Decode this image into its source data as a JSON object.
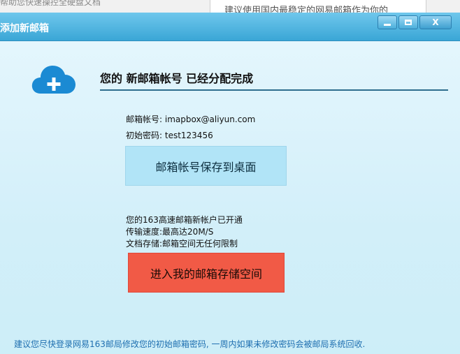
{
  "background_app": {
    "left_text": "帮助您快速操控全硬盘文档",
    "right_text": "建议使用国内最稳定的网易邮箱作为你的"
  },
  "window": {
    "title": "添加新邮箱",
    "controls": {
      "minimize_icon": "minimize-icon",
      "maximize_icon": "maximize-icon",
      "close_label": "X"
    }
  },
  "main": {
    "icon": "cloud-add-icon",
    "headline": "您的 新邮箱帐号 已经分配完成",
    "account_line": "邮箱帐号: imapbox@aliyun.com",
    "password_line": "初始密码: test123456",
    "save_button_label": "邮箱帐号保存到桌面",
    "notice_line_1": "您的163高速邮箱新帐户已开通",
    "notice_line_2": "传输速度:最高达20M/S",
    "notice_line_3": "文档存储:邮箱空间无任何限制",
    "enter_button_label": "进入我的邮箱存储空间"
  },
  "footer": {
    "note": "建议您尽快登录网易163邮局修改您的初始邮箱密码, 一周内如果未修改密码会被邮局系统回收."
  },
  "colors": {
    "titlebar": "#3aa6d6",
    "save_button": "#b1e4f7",
    "enter_button": "#f15a46",
    "footer_text": "#1f6fb0"
  }
}
